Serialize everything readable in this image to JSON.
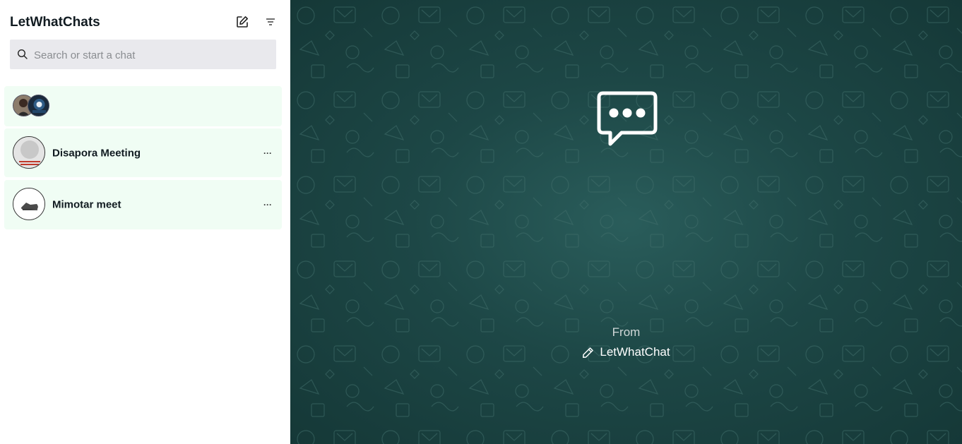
{
  "sidebar": {
    "title": "LetWhatChats",
    "compose_icon": "compose-icon",
    "filter_icon": "filter-icon",
    "search": {
      "placeholder": "Search or start a chat",
      "value": "",
      "icon": "search-icon"
    },
    "chats": [
      {
        "name": "",
        "avatar": "group-avatars",
        "more": ""
      },
      {
        "name": "Disapora Meeting",
        "avatar": "event-flyer",
        "more": "···"
      },
      {
        "name": "Mimotar meet",
        "avatar": "sneaker",
        "more": "···"
      }
    ]
  },
  "main": {
    "icon": "chat-bubble-icon",
    "from_label": "From",
    "brand": "LetWhatChat",
    "brand_icon": "pencil-icon",
    "colors": {
      "background": "#1d4746",
      "accent": "#ffffff"
    }
  }
}
